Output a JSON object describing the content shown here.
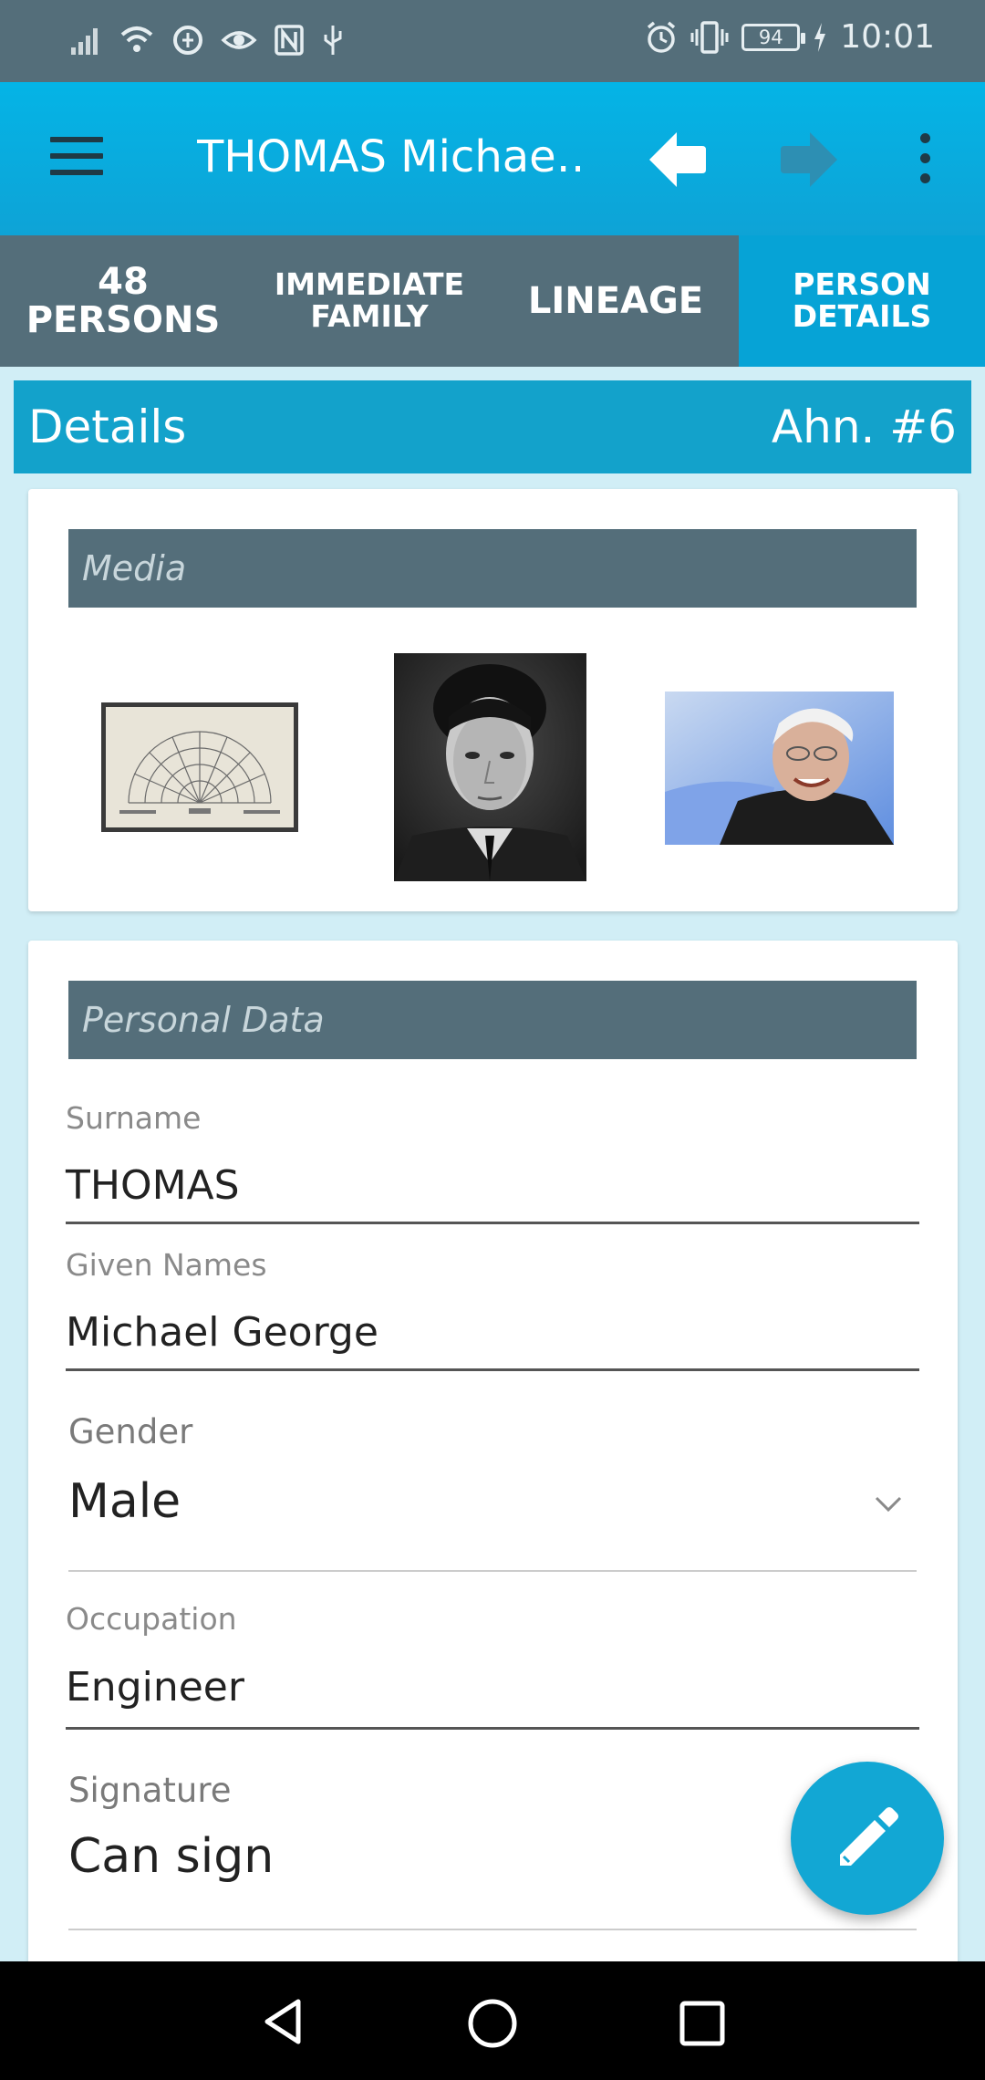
{
  "status_bar": {
    "time": "10:01",
    "battery": "94",
    "left_icons": [
      "signal-icon",
      "wifi-icon",
      "data-saver-icon",
      "eye-icon",
      "nfc-icon",
      "usb-icon"
    ],
    "right_icons": [
      "alarm-icon",
      "vibrate-icon",
      "battery-icon",
      "charging-icon"
    ]
  },
  "toolbar": {
    "title": "THOMAS Michae…",
    "menu_icon": "hamburger-menu-icon",
    "back_icon": "arrow-left-icon",
    "forward_icon": "arrow-right-icon",
    "more_icon": "more-vert-icon"
  },
  "tabs": [
    {
      "label": "48 PERSONS",
      "active": false
    },
    {
      "label": "IMMEDIATE FAMILY",
      "active": false
    },
    {
      "label": "LINEAGE",
      "active": false
    },
    {
      "label": "PERSON DETAILS",
      "active": true
    }
  ],
  "details_header": {
    "title": "Details",
    "ahnentafel": "Ahn. #6"
  },
  "media": {
    "section_title": "Media",
    "items": [
      "fan-chart-image",
      "young-man-portrait",
      "old-man-photo"
    ]
  },
  "personal_data": {
    "section_title": "Personal Data",
    "surname": {
      "label": "Surname",
      "value": "THOMAS"
    },
    "given_names": {
      "label": "Given Names",
      "value": "Michael George"
    },
    "gender": {
      "label": "Gender",
      "value": "Male"
    },
    "occupation": {
      "label": "Occupation",
      "value": "Engineer"
    },
    "signature": {
      "label": "Signature",
      "value": "Can sign"
    }
  },
  "fab": {
    "icon": "pencil-edit-icon"
  },
  "nav_bar": {
    "icons": [
      "nav-back-icon",
      "nav-home-icon",
      "nav-recents-icon"
    ]
  },
  "colors": {
    "primary": "#04b4e6",
    "primary_dark": "#546e7a",
    "accent": "#12a7d4",
    "background": "#d1eef6"
  }
}
